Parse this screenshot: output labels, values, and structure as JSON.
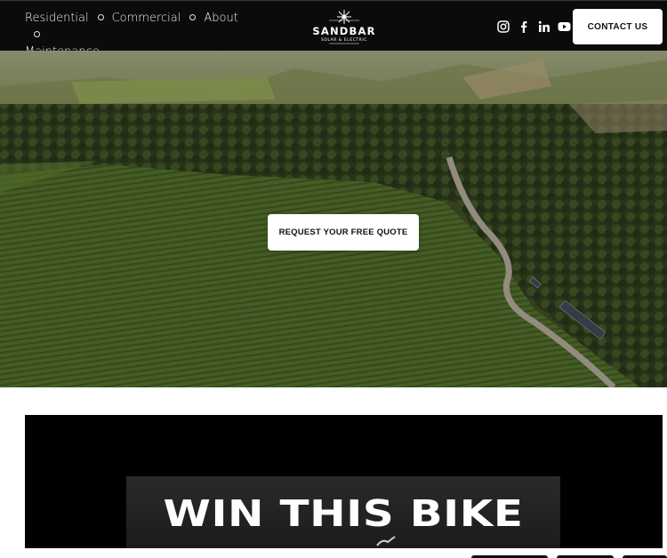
{
  "header": {
    "nav": [
      {
        "label": "Residential"
      },
      {
        "label": "Commercial"
      },
      {
        "label": "About"
      },
      {
        "label": "Maintenance"
      }
    ],
    "logo_alt": "SANDBAR SOLAR & ELECTRIC",
    "social": [
      "instagram-icon",
      "facebook-icon",
      "linkedin-icon",
      "youtube-icon"
    ],
    "contact_label": "CONTACT US"
  },
  "hero": {
    "cta_label": "REQUEST YOUR FREE QUOTE"
  },
  "promo": {
    "title": "WIN THIS BIKE"
  }
}
